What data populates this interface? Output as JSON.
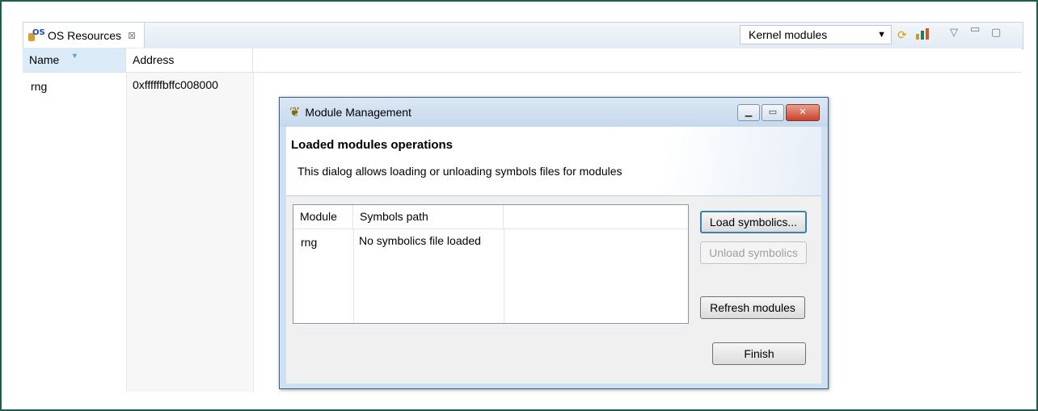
{
  "view": {
    "tab_label": "OS Resources",
    "tab_close": "⊠",
    "selector_value": "Kernel modules"
  },
  "table": {
    "columns": [
      "Name",
      "Address"
    ],
    "rows": [
      {
        "name": "rng",
        "address": "0xffffffbffc008000"
      }
    ]
  },
  "dialog": {
    "title": "Module Management",
    "heading": "Loaded modules operations",
    "description": "This dialog allows loading or unloading symbols files for modules",
    "table": {
      "columns": [
        "Module",
        "Symbols path"
      ],
      "rows": [
        {
          "module": "rng",
          "symbols_path": "No symbolics file loaded"
        }
      ]
    },
    "buttons": {
      "load": "Load symbolics...",
      "unload": "Unload symbolics",
      "refresh": "Refresh modules",
      "finish": "Finish"
    }
  },
  "icons": [
    "os-resources-icon",
    "close-icon",
    "dropdown-arrow-icon",
    "refresh-icon",
    "chart-icon",
    "view-menu-icon",
    "minimize-icon",
    "maximize-icon",
    "dialog-icon"
  ],
  "colors": {
    "frame": "#1f5c4c",
    "selected_column": "#dcebf8",
    "dialog_frame": "#cfe0f2",
    "close_button": "#c9432c"
  }
}
